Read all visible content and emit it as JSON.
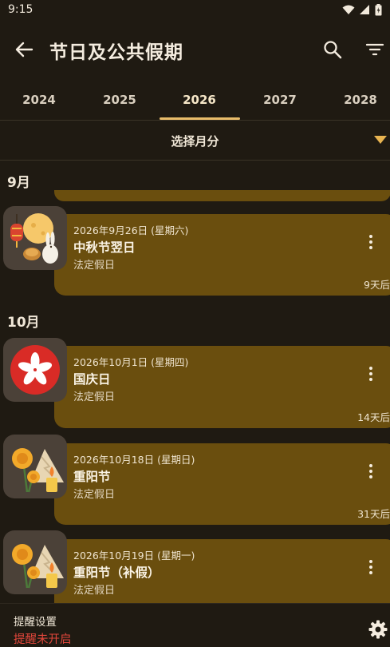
{
  "status_bar": {
    "time": "9:15"
  },
  "app_bar": {
    "title": "节日及公共假期"
  },
  "tabs": [
    "2024",
    "2025",
    "2026",
    "2027",
    "2028"
  ],
  "selected_tab": "2026",
  "month_select": {
    "label": "选择月分"
  },
  "sections": [
    {
      "month": "9月",
      "items": [
        {
          "date": "2026年9月26日 (星期六)",
          "name": "中秋节翌日",
          "type": "法定假日",
          "countdown": "9天后",
          "icon": "mid-autumn-icon"
        }
      ]
    },
    {
      "month": "10月",
      "items": [
        {
          "date": "2026年10月1日 (星期四)",
          "name": "国庆日",
          "type": "法定假日",
          "countdown": "14天后",
          "icon": "hong-kong-flag-icon"
        },
        {
          "date": "2026年10月18日 (星期日)",
          "name": "重阳节",
          "type": "法定假日",
          "countdown": "31天后",
          "icon": "chung-yeung-icon"
        },
        {
          "date": "2026年10月19日 (星期一)",
          "name": "重阳节（补假）",
          "type": "法定假日",
          "icon": "chung-yeung-icon"
        }
      ]
    }
  ],
  "reminder": {
    "title": "提醒设置",
    "status": "提醒未开启"
  },
  "colors": {
    "background": "#1f1a12",
    "card": "#6a4e0e",
    "accent": "#e8bc6a",
    "warning": "#e0463b"
  }
}
